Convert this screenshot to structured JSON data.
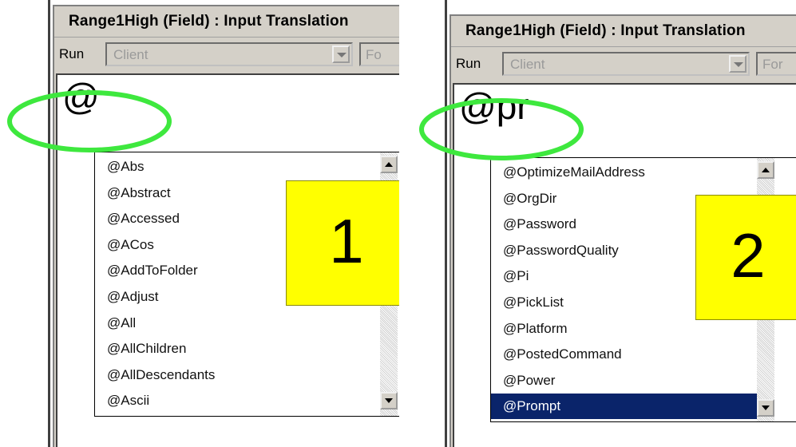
{
  "colors": {
    "highlight_ellipse": "#3ee83e",
    "badge": "#ffff00",
    "selected_row": "#0a246a",
    "dialog_bg": "#d4d0c8"
  },
  "panels": [
    {
      "title": "Range1High (Field) : Input Translation",
      "run_label": "Run",
      "run_value": "Client",
      "second_combo_text": "Fo",
      "typed_text": "@",
      "badge_number": "1",
      "list_items": [
        "@Abs",
        "@Abstract",
        "@Accessed",
        "@ACos",
        "@AddToFolder",
        "@Adjust",
        "@All",
        "@AllChildren",
        "@AllDescendants",
        "@Ascii"
      ],
      "selected_index": -1
    },
    {
      "title": "Range1High (Field) : Input Translation",
      "run_label": "Run",
      "run_value": "Client",
      "second_combo_text": "For",
      "typed_text": "@pr",
      "badge_number": "2",
      "list_items": [
        "@OptimizeMailAddress",
        "@OrgDir",
        "@Password",
        "@PasswordQuality",
        "@Pi",
        "@PickList",
        "@Platform",
        "@PostedCommand",
        "@Power",
        "@Prompt"
      ],
      "selected_index": 9
    }
  ]
}
